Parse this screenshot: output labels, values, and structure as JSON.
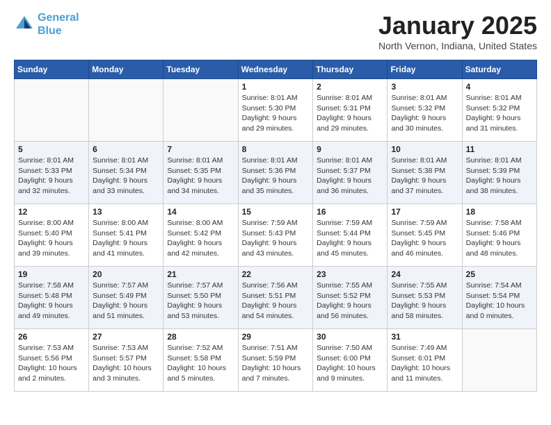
{
  "header": {
    "logo_line1": "General",
    "logo_line2": "Blue",
    "month": "January 2025",
    "location": "North Vernon, Indiana, United States"
  },
  "weekdays": [
    "Sunday",
    "Monday",
    "Tuesday",
    "Wednesday",
    "Thursday",
    "Friday",
    "Saturday"
  ],
  "weeks": [
    [
      {
        "day": "",
        "content": ""
      },
      {
        "day": "",
        "content": ""
      },
      {
        "day": "",
        "content": ""
      },
      {
        "day": "1",
        "content": "Sunrise: 8:01 AM\nSunset: 5:30 PM\nDaylight: 9 hours and 29 minutes."
      },
      {
        "day": "2",
        "content": "Sunrise: 8:01 AM\nSunset: 5:31 PM\nDaylight: 9 hours and 29 minutes."
      },
      {
        "day": "3",
        "content": "Sunrise: 8:01 AM\nSunset: 5:32 PM\nDaylight: 9 hours and 30 minutes."
      },
      {
        "day": "4",
        "content": "Sunrise: 8:01 AM\nSunset: 5:32 PM\nDaylight: 9 hours and 31 minutes."
      }
    ],
    [
      {
        "day": "5",
        "content": "Sunrise: 8:01 AM\nSunset: 5:33 PM\nDaylight: 9 hours and 32 minutes."
      },
      {
        "day": "6",
        "content": "Sunrise: 8:01 AM\nSunset: 5:34 PM\nDaylight: 9 hours and 33 minutes."
      },
      {
        "day": "7",
        "content": "Sunrise: 8:01 AM\nSunset: 5:35 PM\nDaylight: 9 hours and 34 minutes."
      },
      {
        "day": "8",
        "content": "Sunrise: 8:01 AM\nSunset: 5:36 PM\nDaylight: 9 hours and 35 minutes."
      },
      {
        "day": "9",
        "content": "Sunrise: 8:01 AM\nSunset: 5:37 PM\nDaylight: 9 hours and 36 minutes."
      },
      {
        "day": "10",
        "content": "Sunrise: 8:01 AM\nSunset: 5:38 PM\nDaylight: 9 hours and 37 minutes."
      },
      {
        "day": "11",
        "content": "Sunrise: 8:01 AM\nSunset: 5:39 PM\nDaylight: 9 hours and 38 minutes."
      }
    ],
    [
      {
        "day": "12",
        "content": "Sunrise: 8:00 AM\nSunset: 5:40 PM\nDaylight: 9 hours and 39 minutes."
      },
      {
        "day": "13",
        "content": "Sunrise: 8:00 AM\nSunset: 5:41 PM\nDaylight: 9 hours and 41 minutes."
      },
      {
        "day": "14",
        "content": "Sunrise: 8:00 AM\nSunset: 5:42 PM\nDaylight: 9 hours and 42 minutes."
      },
      {
        "day": "15",
        "content": "Sunrise: 7:59 AM\nSunset: 5:43 PM\nDaylight: 9 hours and 43 minutes."
      },
      {
        "day": "16",
        "content": "Sunrise: 7:59 AM\nSunset: 5:44 PM\nDaylight: 9 hours and 45 minutes."
      },
      {
        "day": "17",
        "content": "Sunrise: 7:59 AM\nSunset: 5:45 PM\nDaylight: 9 hours and 46 minutes."
      },
      {
        "day": "18",
        "content": "Sunrise: 7:58 AM\nSunset: 5:46 PM\nDaylight: 9 hours and 48 minutes."
      }
    ],
    [
      {
        "day": "19",
        "content": "Sunrise: 7:58 AM\nSunset: 5:48 PM\nDaylight: 9 hours and 49 minutes."
      },
      {
        "day": "20",
        "content": "Sunrise: 7:57 AM\nSunset: 5:49 PM\nDaylight: 9 hours and 51 minutes."
      },
      {
        "day": "21",
        "content": "Sunrise: 7:57 AM\nSunset: 5:50 PM\nDaylight: 9 hours and 53 minutes."
      },
      {
        "day": "22",
        "content": "Sunrise: 7:56 AM\nSunset: 5:51 PM\nDaylight: 9 hours and 54 minutes."
      },
      {
        "day": "23",
        "content": "Sunrise: 7:55 AM\nSunset: 5:52 PM\nDaylight: 9 hours and 56 minutes."
      },
      {
        "day": "24",
        "content": "Sunrise: 7:55 AM\nSunset: 5:53 PM\nDaylight: 9 hours and 58 minutes."
      },
      {
        "day": "25",
        "content": "Sunrise: 7:54 AM\nSunset: 5:54 PM\nDaylight: 10 hours and 0 minutes."
      }
    ],
    [
      {
        "day": "26",
        "content": "Sunrise: 7:53 AM\nSunset: 5:56 PM\nDaylight: 10 hours and 2 minutes."
      },
      {
        "day": "27",
        "content": "Sunrise: 7:53 AM\nSunset: 5:57 PM\nDaylight: 10 hours and 3 minutes."
      },
      {
        "day": "28",
        "content": "Sunrise: 7:52 AM\nSunset: 5:58 PM\nDaylight: 10 hours and 5 minutes."
      },
      {
        "day": "29",
        "content": "Sunrise: 7:51 AM\nSunset: 5:59 PM\nDaylight: 10 hours and 7 minutes."
      },
      {
        "day": "30",
        "content": "Sunrise: 7:50 AM\nSunset: 6:00 PM\nDaylight: 10 hours and 9 minutes."
      },
      {
        "day": "31",
        "content": "Sunrise: 7:49 AM\nSunset: 6:01 PM\nDaylight: 10 hours and 11 minutes."
      },
      {
        "day": "",
        "content": ""
      }
    ]
  ]
}
